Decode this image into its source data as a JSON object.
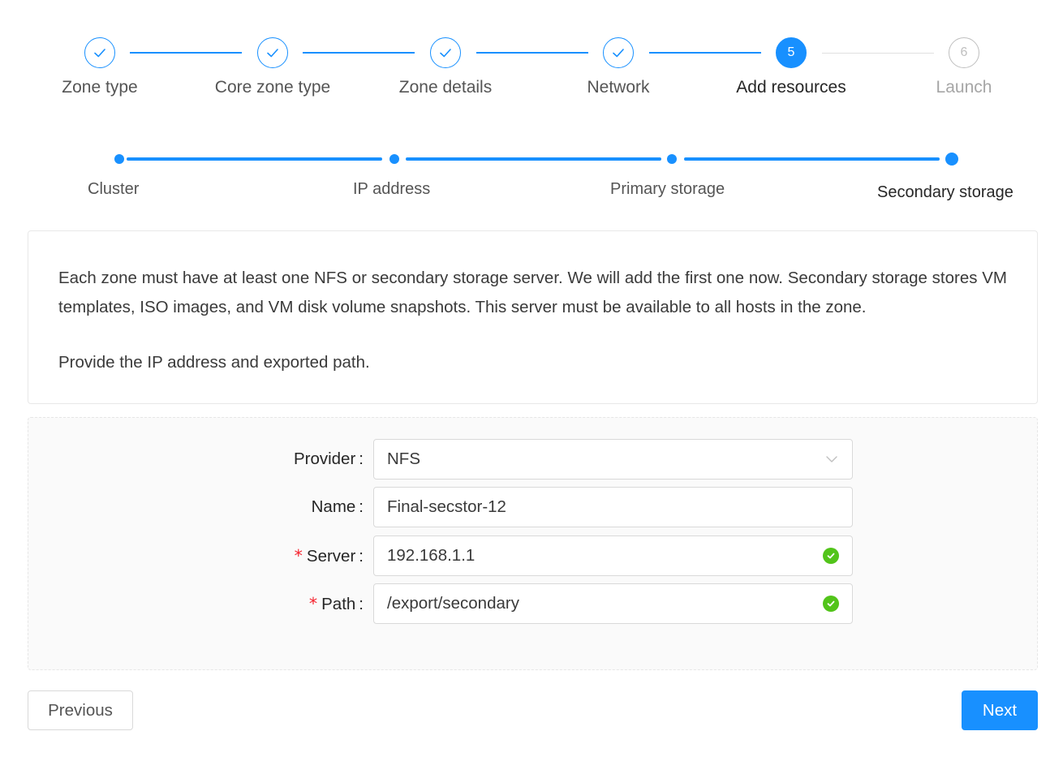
{
  "wizard": {
    "steps": [
      {
        "label": "Zone type",
        "status": "finished"
      },
      {
        "label": "Core zone type",
        "status": "finished"
      },
      {
        "label": "Zone details",
        "status": "finished"
      },
      {
        "label": "Network",
        "status": "finished"
      },
      {
        "label": "Add resources",
        "status": "active",
        "number": "5"
      },
      {
        "label": "Launch",
        "status": "wait",
        "number": "6"
      }
    ],
    "substeps": [
      {
        "label": "Cluster"
      },
      {
        "label": "IP address"
      },
      {
        "label": "Primary storage"
      },
      {
        "label": "Secondary storage",
        "current": true
      }
    ]
  },
  "description": {
    "paragraph1": "Each zone must have at least one NFS or secondary storage server. We will add the first one now. Secondary storage stores VM templates, ISO images, and VM disk volume snapshots. This server must be available to all hosts in the zone.",
    "paragraph2": "Provide the IP address and exported path."
  },
  "form": {
    "provider": {
      "label": "Provider",
      "value": "NFS"
    },
    "name": {
      "label": "Name",
      "value": "Final-secstor-12"
    },
    "server": {
      "label": "Server",
      "value": "192.168.1.1",
      "required": true,
      "valid": true
    },
    "path": {
      "label": "Path",
      "value": "/export/secondary",
      "required": true,
      "valid": true
    }
  },
  "buttons": {
    "previous": "Previous",
    "next": "Next"
  },
  "colors": {
    "primary": "#1890ff",
    "success": "#52c41a",
    "required": "#f5222d"
  },
  "icons": {
    "finished_step": "check-icon",
    "select_arrow": "chevron-down-icon",
    "validation": "check-circle-icon"
  }
}
